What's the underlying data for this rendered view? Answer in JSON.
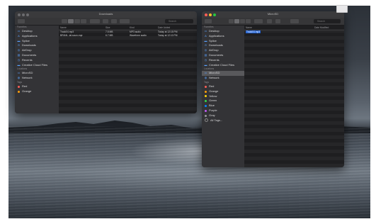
{
  "colors": {
    "accent": "#1f5fd0",
    "close": "#ff5f57",
    "minimize": "#febc2e",
    "zoom": "#28c840"
  },
  "desktop_icon": {
    "name": ""
  },
  "left_window": {
    "title": "Downloads",
    "search_placeholder": "Search",
    "sidebar": {
      "favorites_header": "Favorites",
      "favorites": [
        {
          "icon": "desktop-icon",
          "label": "Desktop"
        },
        {
          "icon": "applications-icon",
          "label": "Applications"
        },
        {
          "icon": "folder-icon",
          "label": "Splice"
        },
        {
          "icon": "downloads-icon",
          "label": "Downloads"
        },
        {
          "icon": "airdrop-icon",
          "label": "AirDrop"
        },
        {
          "icon": "documents-icon",
          "label": "Documents"
        },
        {
          "icon": "recents-icon",
          "label": "Recents"
        },
        {
          "icon": "folder-icon",
          "label": "Creative Cloud Files"
        }
      ],
      "locations_header": "Locations",
      "locations": [
        {
          "icon": "drive-icon",
          "label": "MicroSD"
        },
        {
          "icon": "network-icon",
          "label": "Network"
        }
      ],
      "tags_header": "Tags",
      "tags": [
        {
          "color": "#ff5f57",
          "label": "Red"
        },
        {
          "color": "#ff9f0a",
          "label": "Orange"
        }
      ]
    },
    "columns": [
      "Name",
      "Size",
      "Kind",
      "Date Added"
    ],
    "rows": [
      {
        "name": "Track04.mp3",
        "size": "7.5 MB",
        "kind": "MP3 audio",
        "date": "Today at 12:15 PM"
      },
      {
        "name": "BRIAN...ial.sourc.eqe",
        "size": "6.7 MB",
        "kind": "Waveform audio",
        "date": "Today at 12:10 PM"
      }
    ]
  },
  "right_window": {
    "title": "MicroSD",
    "search_placeholder": "Search",
    "sidebar": {
      "favorites_header": "Favorites",
      "favorites": [
        {
          "icon": "desktop-icon",
          "label": "Desktop"
        },
        {
          "icon": "applications-icon",
          "label": "Applications"
        },
        {
          "icon": "folder-icon",
          "label": "Splice"
        },
        {
          "icon": "downloads-icon",
          "label": "Downloads"
        },
        {
          "icon": "airdrop-icon",
          "label": "AirDrop"
        },
        {
          "icon": "documents-icon",
          "label": "Documents"
        },
        {
          "icon": "recents-icon",
          "label": "Recents"
        },
        {
          "icon": "folder-icon",
          "label": "Creative Cloud Files"
        }
      ],
      "locations_header": "Locations",
      "locations": [
        {
          "icon": "drive-icon",
          "label": "MicroSD"
        },
        {
          "icon": "network-icon",
          "label": "Network"
        }
      ],
      "tags_header": "Tags",
      "tags": [
        {
          "color": "#ff5f57",
          "label": "Red"
        },
        {
          "color": "#ff9f0a",
          "label": "Orange"
        },
        {
          "color": "#ffd60a",
          "label": "Yellow"
        },
        {
          "color": "#32d74b",
          "label": "Green"
        },
        {
          "color": "#0a84ff",
          "label": "Blue"
        },
        {
          "color": "#bf5af2",
          "label": "Purple"
        },
        {
          "color": "#98989d",
          "label": "Gray"
        },
        {
          "color": "",
          "label": "All Tags..."
        }
      ]
    },
    "columns": [
      "Name",
      "Date Modified"
    ],
    "rows": [
      {
        "name": "Track04.mp3",
        "date": ""
      }
    ]
  }
}
